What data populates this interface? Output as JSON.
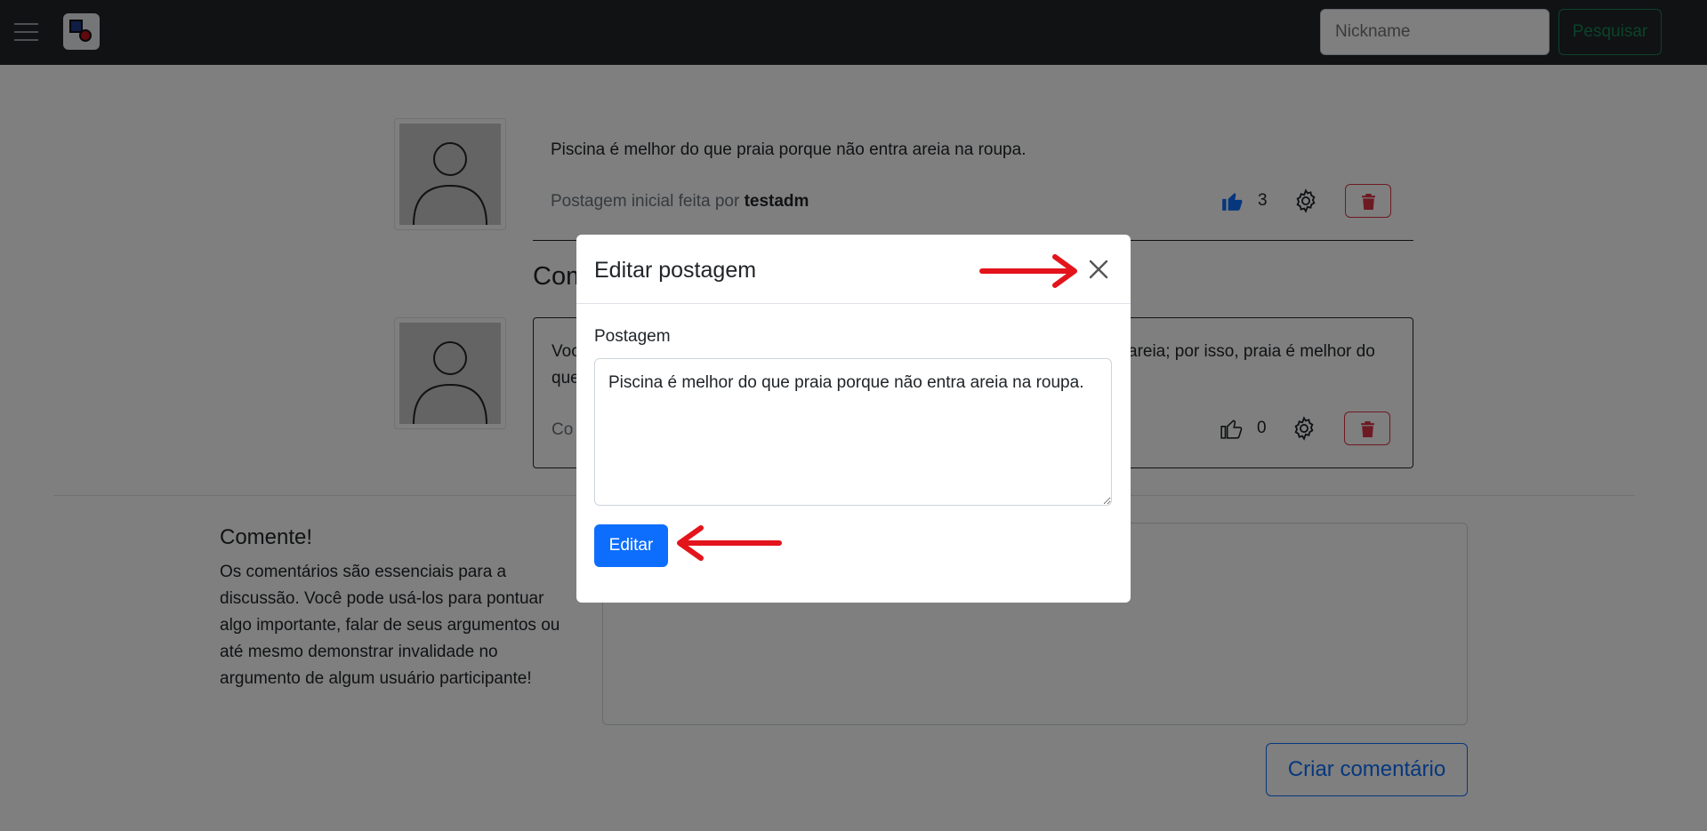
{
  "navbar": {
    "search_placeholder": "Nickname",
    "search_button": "Pesquisar",
    "icons": [
      "hamburger-icon",
      "app-logo"
    ]
  },
  "post": {
    "text": "Piscina é melhor do que praia porque não entra areia na roupa.",
    "meta_prefix": "Postagem inicial feita por",
    "author": "testadm",
    "likes": "3"
  },
  "comments_section": {
    "title_visible": "Com",
    "comment": {
      "text_left": "Voc",
      "text_left_line2": "que",
      "text_right": "areia; por isso, praia é melhor do",
      "meta_visible": "Co",
      "likes": "0"
    }
  },
  "comment_form": {
    "title": "Comente!",
    "description": "Os comentários são essenciais para a discussão. Você pode usá-los para pontuar algo importante, falar de seus argumentos ou até mesmo demonstrar invalidade no argumento de algum usuário participante!",
    "submit_label": "Criar comentário"
  },
  "modal": {
    "title": "Editar postagem",
    "field_label": "Postagem",
    "field_value": "Piscina é melhor do que praia porque não entra areia na roupa.",
    "submit_label": "Editar"
  },
  "colors": {
    "navbar_bg": "#212529",
    "primary": "#0d6efd",
    "danger": "#dc3545",
    "success": "#198754",
    "annotation_arrow": "#e3141b"
  }
}
